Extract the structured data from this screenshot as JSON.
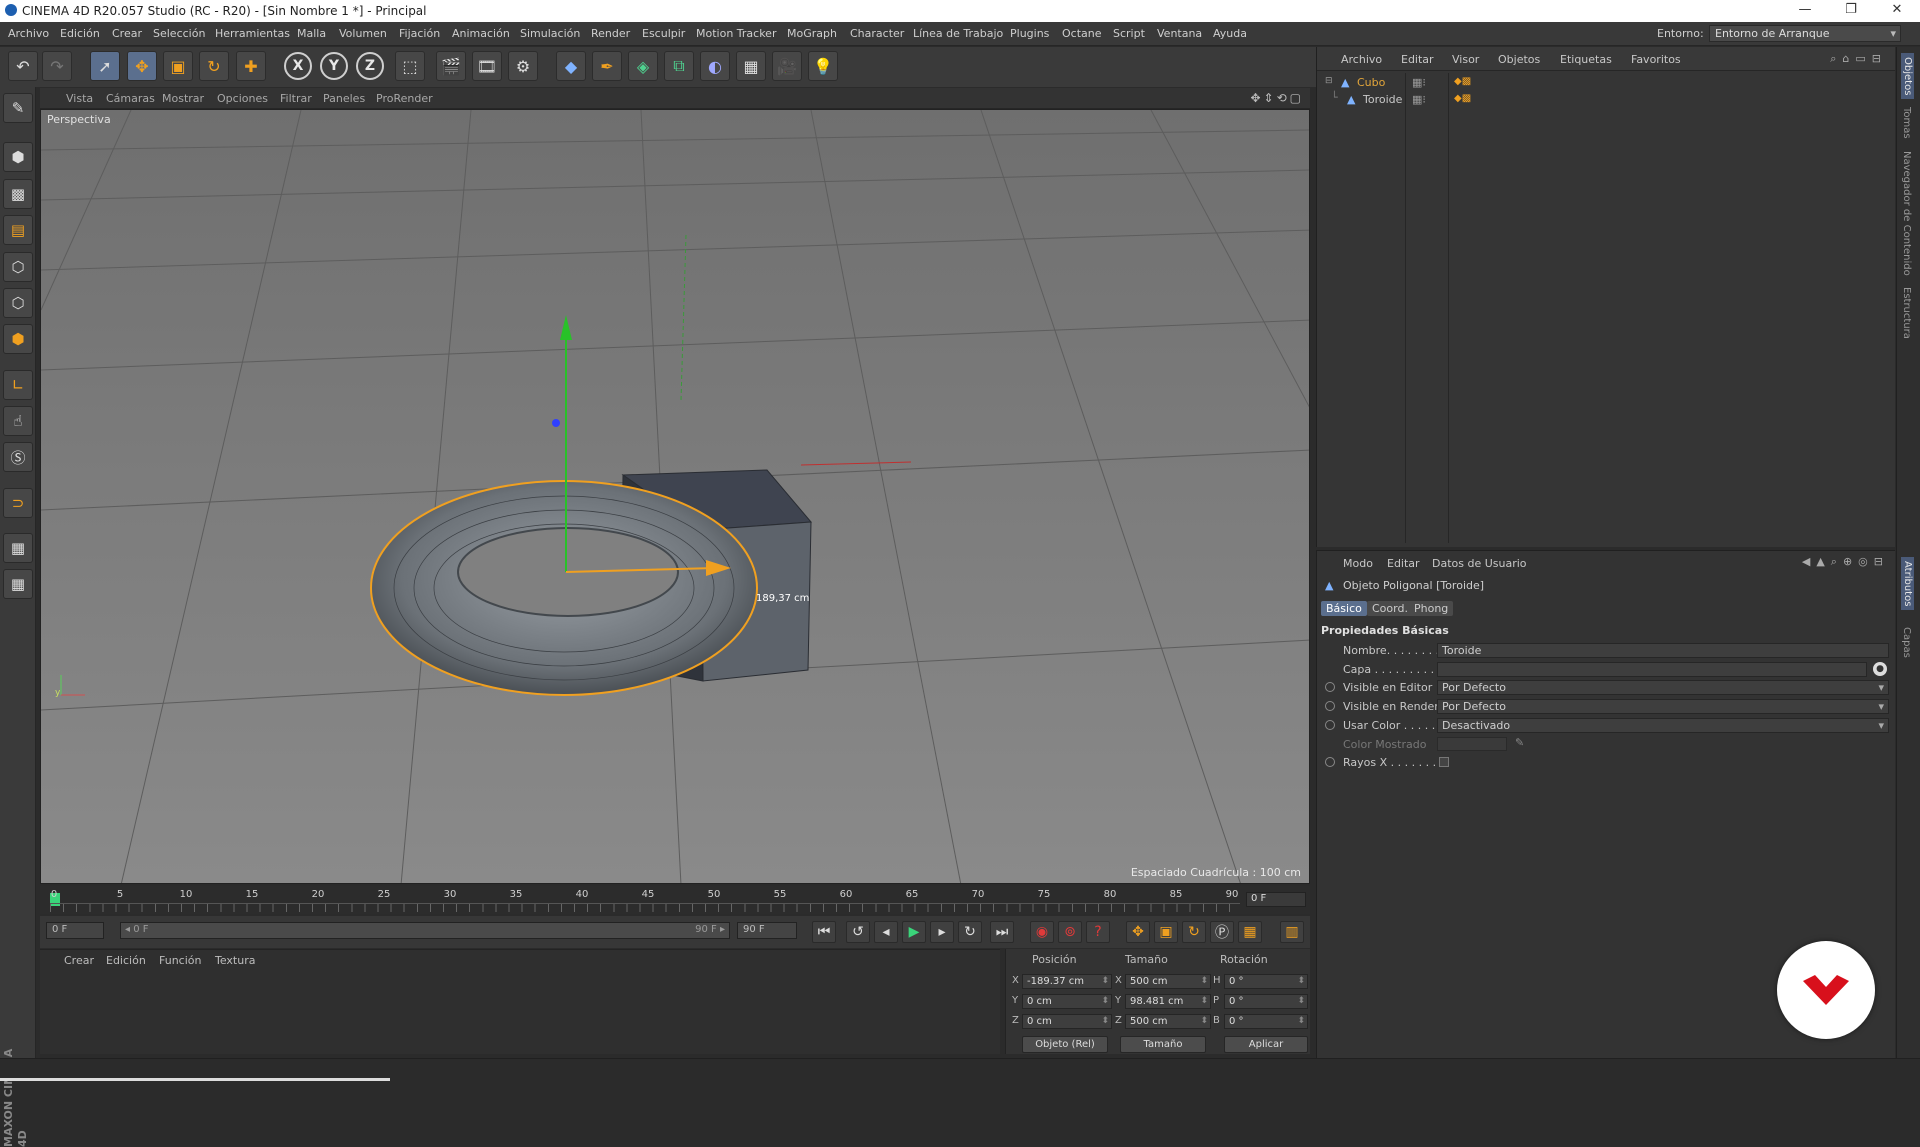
{
  "window": {
    "title": "CINEMA 4D R20.057 Studio (RC - R20) - [Sin Nombre 1 *] - Principal",
    "minimize": "—",
    "restore": "❐",
    "close": "✕"
  },
  "menubar": {
    "items": [
      "Archivo",
      "Edición",
      "Crear",
      "Selección",
      "Herramientas",
      "Malla",
      "Volumen",
      "Fijación",
      "Animación",
      "Simulación",
      "Render",
      "Esculpir",
      "Motion Tracker",
      "MoGraph",
      "Character",
      "Línea de Trabajo",
      "Plugins",
      "Octane",
      "Script",
      "Ventana",
      "Ayuda"
    ],
    "environment_label": "Entorno:",
    "environment_value": "Entorno de Arranque"
  },
  "toolbar": {
    "icons": [
      "undo-icon",
      "redo-icon",
      "live-selection-icon",
      "move-icon",
      "scale-icon",
      "rotate-icon",
      "last-tool-icon",
      "x-axis-icon",
      "y-axis-icon",
      "z-axis-icon",
      "coordinate-system-icon",
      "render-view-icon",
      "render-picture-viewer-icon",
      "edit-render-settings-icon",
      "cube-icon",
      "pen-spline-icon",
      "subdivision-surface-icon",
      "array-icon",
      "deformer-icon",
      "floor-icon",
      "camera-icon",
      "light-icon"
    ],
    "x_label": "X",
    "y_label": "Y",
    "z_label": "Z"
  },
  "viewport": {
    "menu": [
      "Vista",
      "Cámaras",
      "Mostrar",
      "Opciones",
      "Filtrar",
      "Paneles",
      "ProRender"
    ],
    "label": "Perspectiva",
    "grid_spacing": "Espaciado Cuadrícula : 100 cm",
    "distance_readout": "189,37 cm"
  },
  "timeline": {
    "ticks": [
      "0",
      "5",
      "10",
      "15",
      "20",
      "25",
      "30",
      "35",
      "40",
      "45",
      "50",
      "55",
      "60",
      "65",
      "70",
      "75",
      "80",
      "85",
      "90"
    ],
    "current_frame": "0 F",
    "start_field": "0 F",
    "range_start": "◂ 0 F",
    "range_end": "90 F ▸",
    "end_field": "90 F"
  },
  "materials": {
    "menu": [
      "Crear",
      "Edición",
      "Función",
      "Textura"
    ]
  },
  "coordinates": {
    "headers": {
      "position": "Posición",
      "size": "Tamaño",
      "rotation": "Rotación"
    },
    "rows": [
      {
        "axis": "X",
        "pos": "-189.37 cm",
        "size_axis": "X",
        "size": "500 cm",
        "rot_axis": "H",
        "rot": "0 °"
      },
      {
        "axis": "Y",
        "pos": "0 cm",
        "size_axis": "Y",
        "size": "98.481 cm",
        "rot_axis": "P",
        "rot": "0 °"
      },
      {
        "axis": "Z",
        "pos": "0 cm",
        "size_axis": "Z",
        "size": "500 cm",
        "rot_axis": "B",
        "rot": "0 °"
      }
    ],
    "mode_select": "Objeto (Rel)",
    "size_select": "Tamaño",
    "apply": "Aplicar"
  },
  "object_manager": {
    "menu": [
      "Archivo",
      "Editar",
      "Visor",
      "Objetos",
      "Etiquetas",
      "Favoritos"
    ],
    "objects": [
      {
        "name": "Cubo",
        "color": "#e2a53a"
      },
      {
        "name": "Toroide",
        "color": "#f0a020"
      }
    ]
  },
  "attributes": {
    "menu": [
      "Modo",
      "Editar",
      "Datos de Usuario"
    ],
    "title": "Objeto Poligonal [Toroide]",
    "tabs": [
      "Básico",
      "Coord.",
      "Phong"
    ],
    "section": "Propiedades Básicas",
    "fields": [
      {
        "label": "Nombre. . . . . . . .",
        "value": "Toroide"
      },
      {
        "label": "Capa . . . . . . . . .",
        "value": ""
      },
      {
        "label": "Visible en Editor",
        "value": "Por Defecto"
      },
      {
        "label": "Visible en Render",
        "value": "Por Defecto"
      },
      {
        "label": "Usar Color . . . . .",
        "value": "Desactivado"
      },
      {
        "label": "Color Mostrado",
        "value": ""
      },
      {
        "label": "Rayos X . . . . . . .",
        "value": ""
      }
    ]
  },
  "side_tabs": [
    "Objetos",
    "Tomas",
    "Navegador de Contenido",
    "Estructura",
    "Atributos",
    "Capas"
  ],
  "colors": {
    "accent_blue": "#5b6f8e",
    "selection_orange": "#f0a020",
    "background": "#2b2b2b"
  }
}
